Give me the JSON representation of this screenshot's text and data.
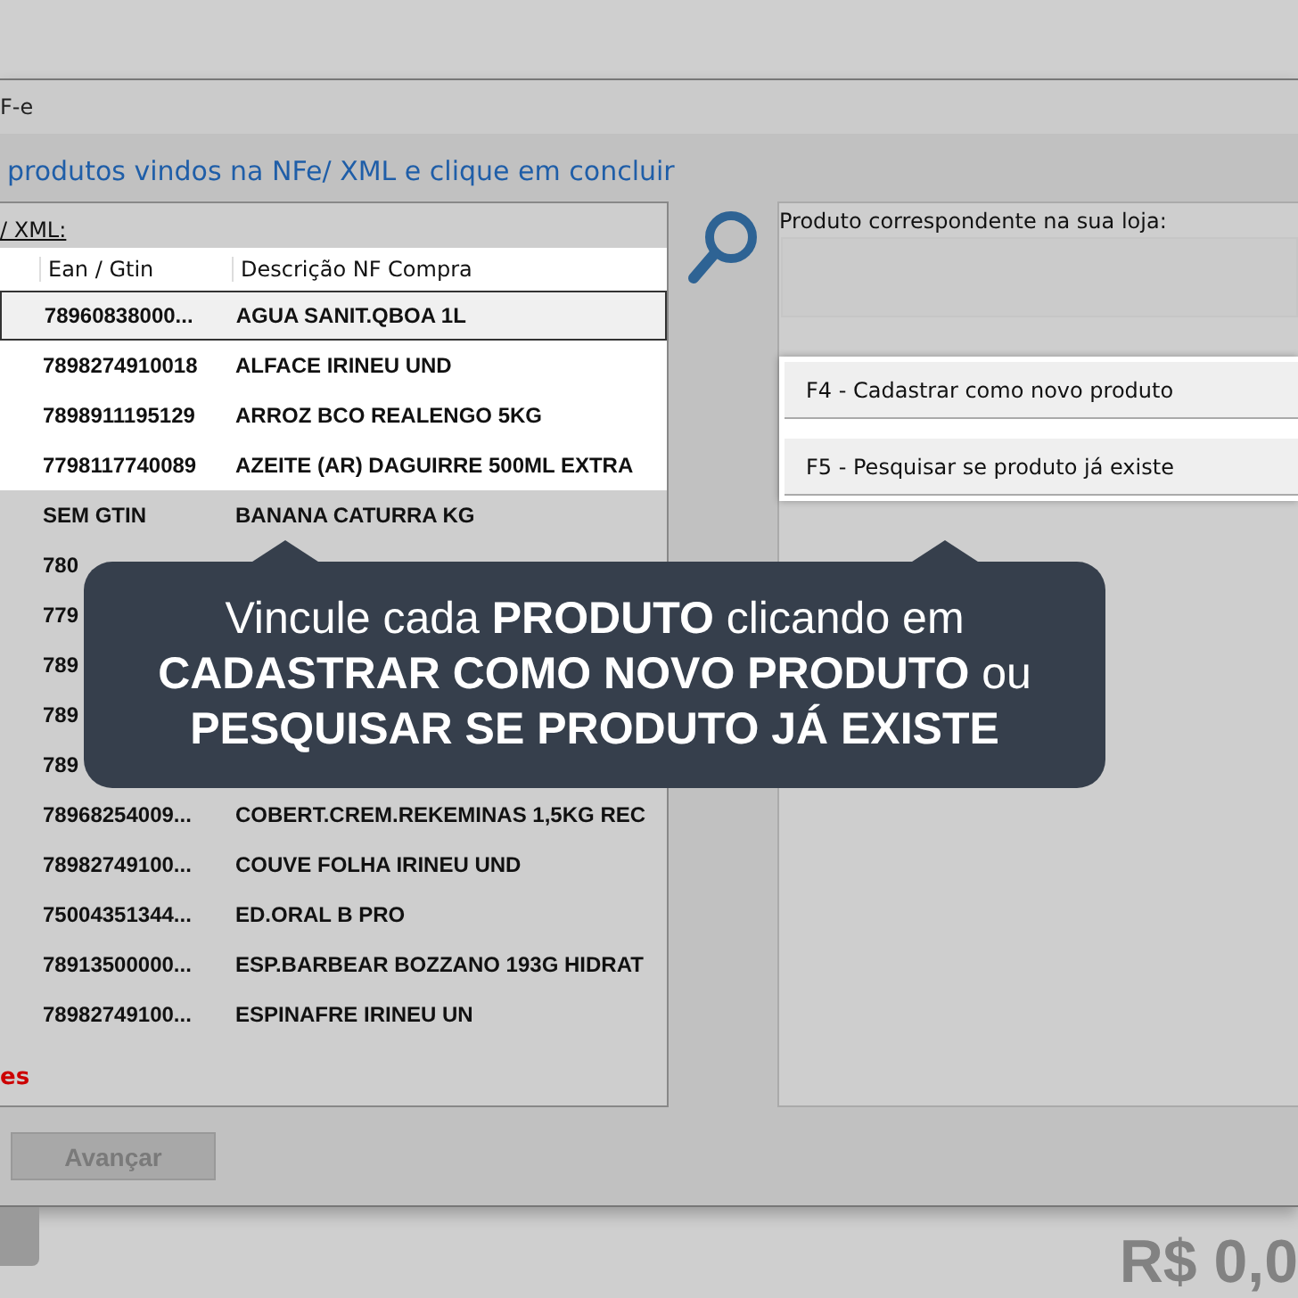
{
  "window": {
    "title": "F-e"
  },
  "instruction": "produtos vindos na NFe/ XML e clique em concluir",
  "left_panel": {
    "label": "/ XML:",
    "columns": [
      "Ean / Gtin",
      "Descrição NF Compra"
    ],
    "rows": [
      {
        "ean": "78960838000...",
        "description": "AGUA SANIT.QBOA 1L",
        "selected": true,
        "highlighted": true
      },
      {
        "ean": "7898274910018",
        "description": "ALFACE IRINEU UND",
        "selected": false,
        "highlighted": true
      },
      {
        "ean": "7898911195129",
        "description": "ARROZ BCO REALENGO 5KG",
        "selected": false,
        "highlighted": true
      },
      {
        "ean": "7798117740089",
        "description": "AZEITE (AR) DAGUIRRE 500ML EXTRA",
        "selected": false,
        "highlighted": true
      },
      {
        "ean": "SEM GTIN",
        "description": "BANANA CATURRA KG",
        "selected": false,
        "highlighted": false
      },
      {
        "ean": "780",
        "selected": false,
        "highlighted": false
      },
      {
        "ean": "779",
        "selected": false,
        "highlighted": false
      },
      {
        "ean": "789",
        "selected": false,
        "highlighted": false
      },
      {
        "ean": "789",
        "selected": false,
        "highlighted": false
      },
      {
        "ean": "789",
        "selected": false,
        "highlighted": false
      },
      {
        "ean": "78968254009...",
        "description": "COBERT.CREM.REKEMINAS 1,5KG REC",
        "selected": false,
        "highlighted": false
      },
      {
        "ean": "78982749100...",
        "description": "COUVE FOLHA IRINEU UND",
        "selected": false,
        "highlighted": false
      },
      {
        "ean": "75004351344...",
        "description": "ED.ORAL B PRO",
        "selected": false,
        "highlighted": false
      },
      {
        "ean": "78913500000...",
        "description": "ESP.BARBEAR BOZZANO 193G HIDRAT",
        "selected": false,
        "highlighted": false
      },
      {
        "ean": "78982749100...",
        "description": "ESPINAFRE IRINEU UN",
        "selected": false,
        "highlighted": false
      }
    ],
    "warning": "es"
  },
  "right_panel": {
    "label": "Produto correspondente na sua loja:",
    "actions": [
      "F4 - Cadastrar como novo produto",
      "F5 - Pesquisar se produto já existe"
    ]
  },
  "advance_button": {
    "label": "Avançar",
    "disabled": true
  },
  "total": "R$ 0,0",
  "tooltip": {
    "lines": [
      "Vincule cada **PRODUTO** clicando em",
      "**CADASTRAR COMO NOVO PRODUTO** ou",
      "**PESQUISAR SE PRODUTO JÁ EXISTE**"
    ]
  }
}
